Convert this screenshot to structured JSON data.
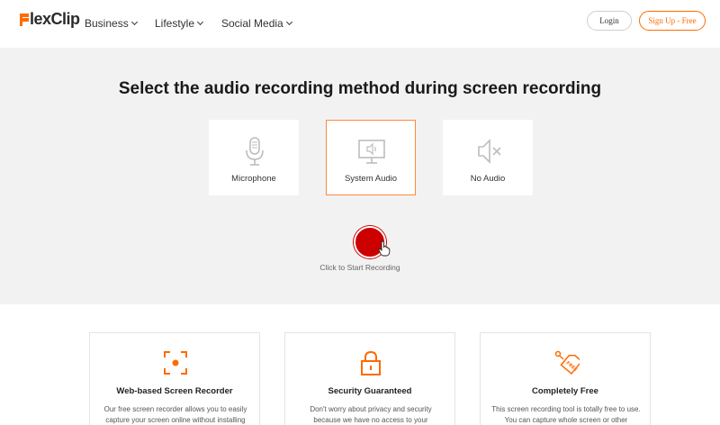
{
  "header": {
    "logo": {
      "part1": "Flex",
      "part2": "Clip",
      "accent": "#ff6a00"
    },
    "nav": [
      {
        "label": "Business"
      },
      {
        "label": "Lifestyle"
      },
      {
        "label": "Social Media"
      }
    ],
    "login_label": "Login",
    "signup_label": "Sign Up - Free"
  },
  "hero": {
    "title": "Select the audio recording method during screen recording",
    "options": [
      {
        "label": "Microphone",
        "icon": "microphone-icon",
        "selected": false
      },
      {
        "label": "System Audio",
        "icon": "system-audio-icon",
        "selected": true
      },
      {
        "label": "No Audio",
        "icon": "mute-icon",
        "selected": false
      }
    ],
    "record_caption": "Click to Start Recording",
    "record_color": "#cc0000"
  },
  "features": [
    {
      "icon": "screen-capture-icon",
      "title": "Web-based Screen Recorder",
      "desc": "Our free screen recorder allows you to easily capture your screen online without installing"
    },
    {
      "icon": "lock-icon",
      "title": "Security Guaranteed",
      "desc": "Don't worry about privacy and security because we have no access to your"
    },
    {
      "icon": "free-tag-icon",
      "title": "Completely Free",
      "desc": "This screen recording tool is totally free to use. You can capture whole screen or other"
    }
  ],
  "colors": {
    "accent": "#ff6a00",
    "hero_bg": "#f2f2f2",
    "selected_border": "#ff8a3c"
  }
}
